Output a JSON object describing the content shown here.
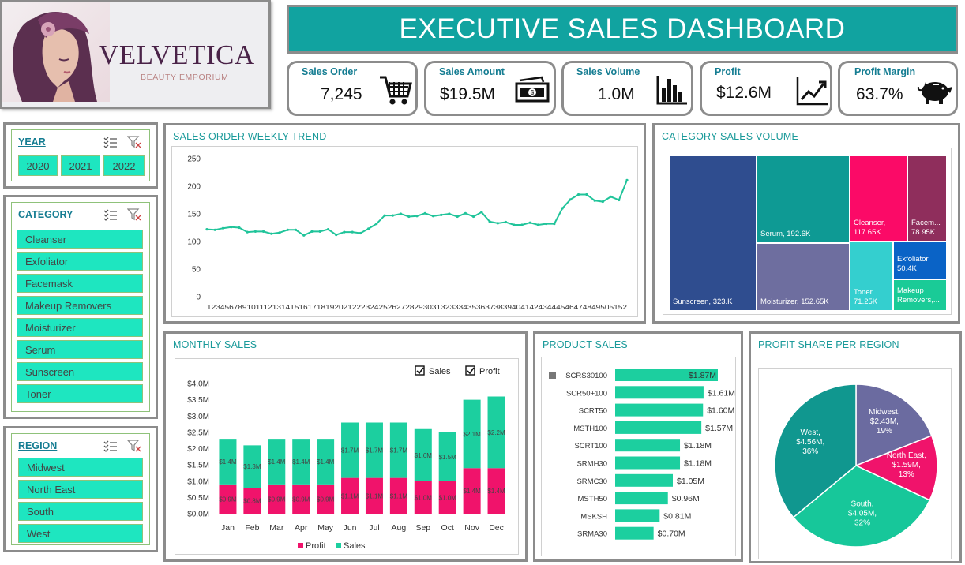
{
  "brand": {
    "name": "VELVETICA",
    "subtitle": "BEAUTY EMPORIUM"
  },
  "title": "EXECUTIVE SALES DASHBOARD",
  "kpis": [
    {
      "label": "Sales Order",
      "value": "7,245",
      "icon": "shopping-cart-icon"
    },
    {
      "label": "Sales Amount",
      "value": "$19.5M",
      "icon": "money-icon"
    },
    {
      "label": "Sales Volume",
      "value": "1.0M",
      "icon": "bar-chart-icon"
    },
    {
      "label": "Profit",
      "value": "$12.6M",
      "icon": "trend-up-icon"
    },
    {
      "label": "Profit Margin",
      "value": "63.7%",
      "icon": "piggy-bank-icon"
    }
  ],
  "slicers": {
    "year": {
      "title": "YEAR",
      "items": [
        "2020",
        "2021",
        "2022"
      ]
    },
    "category": {
      "title": "CATEGORY",
      "items": [
        "Cleanser",
        "Exfoliator",
        "Facemask",
        "Makeup Removers",
        "Moisturizer",
        "Serum",
        "Sunscreen",
        "Toner"
      ]
    },
    "region": {
      "title": "REGION",
      "items": [
        "Midwest",
        "North East",
        "South",
        "West"
      ]
    }
  },
  "colors": {
    "teal": "#11a3a0",
    "slicer_fill": "#1ee6c0",
    "sales": "#1ccf9f",
    "profit": "#f0136b",
    "line": "#20c49a"
  },
  "chart_data": [
    {
      "type": "line",
      "title": "SALES ORDER WEEKLY TREND",
      "x": [
        1,
        2,
        3,
        4,
        5,
        6,
        7,
        8,
        9,
        10,
        11,
        12,
        13,
        14,
        15,
        16,
        17,
        18,
        19,
        20,
        21,
        22,
        23,
        24,
        25,
        26,
        27,
        28,
        29,
        30,
        31,
        32,
        33,
        34,
        35,
        36,
        37,
        38,
        39,
        40,
        41,
        42,
        43,
        44,
        45,
        46,
        47,
        48,
        49,
        50,
        51,
        52
      ],
      "x_tick_labels": "12345678910111213141516171819202122232425262728293031323334353637383940414243444546474849505152",
      "values": [
        122,
        121,
        124,
        126,
        125,
        117,
        118,
        118,
        114,
        116,
        121,
        121,
        111,
        118,
        118,
        122,
        112,
        117,
        117,
        115,
        123,
        132,
        147,
        147,
        150,
        145,
        146,
        151,
        146,
        148,
        150,
        145,
        151,
        145,
        153,
        136,
        133,
        135,
        130,
        130,
        134,
        130,
        132,
        132,
        160,
        176,
        185,
        185,
        174,
        172,
        181,
        175,
        211
      ],
      "ylim": [
        0,
        250
      ],
      "yticks": [
        "0",
        "50",
        "100",
        "150",
        "200",
        "250"
      ],
      "grid": false
    },
    {
      "type": "treemap",
      "title": "CATEGORY SALES VOLUME",
      "items": [
        {
          "label": "Sunscreen, 323.K",
          "value": 323.0,
          "color": "#2f4d8f"
        },
        {
          "label": "Serum, 192.6K",
          "value": 192.6,
          "color": "#0e9a94"
        },
        {
          "label": "Moisturizer, 152.65K",
          "value": 152.65,
          "color": "#6e6e9f"
        },
        {
          "label": "Cleanser, 117.65K",
          "value": 117.65,
          "color": "#fb0a67"
        },
        {
          "label": "Facem...",
          "value_label": "78.95K",
          "value": 78.95,
          "color": "#8f2e5c"
        },
        {
          "label": "Toner, 71.25K",
          "value": 71.25,
          "color": "#34cfcf"
        },
        {
          "label": "Exfoliator, 50.4K",
          "value": 50.4,
          "color": "#0a63c6"
        },
        {
          "label": "Makeup Removers,...",
          "value": 48.0,
          "color": "#1acb97"
        }
      ]
    },
    {
      "type": "bar",
      "title": "MONTHLY SALES",
      "categories": [
        "Jan",
        "Feb",
        "Mar",
        "Apr",
        "May",
        "Jun",
        "Jul",
        "Aug",
        "Sep",
        "Oct",
        "Nov",
        "Dec"
      ],
      "series": [
        {
          "name": "Profit",
          "values": [
            0.9,
            0.8,
            0.9,
            0.9,
            0.9,
            1.1,
            1.1,
            1.1,
            1.0,
            1.0,
            1.4,
            1.4
          ],
          "labels": [
            "$0.9M",
            "$0.8M",
            "$0.9M",
            "$0.9M",
            "$0.9M",
            "$1.1M",
            "$1.1M",
            "$1.1M",
            "$1.0M",
            "$1.0M",
            "$1.4M",
            "$1.4M"
          ]
        },
        {
          "name": "Sales",
          "values": [
            1.4,
            1.3,
            1.4,
            1.4,
            1.4,
            1.7,
            1.7,
            1.7,
            1.6,
            1.5,
            2.1,
            2.2
          ],
          "labels": [
            "$1.4M",
            "$1.3M",
            "$1.4M",
            "$1.4M",
            "$1.4M",
            "$1.7M",
            "$1.7M",
            "$1.7M",
            "$1.6M",
            "$1.5M",
            "$2.1M",
            "$2.2M"
          ]
        }
      ],
      "stacked": true,
      "ylim": [
        0,
        4.0
      ],
      "yticks": [
        "$0.0M",
        "$0.5M",
        "$1.0M",
        "$1.5M",
        "$2.0M",
        "$2.5M",
        "$3.0M",
        "$3.5M",
        "$4.0M"
      ],
      "legend": [
        "Profit",
        "Sales"
      ],
      "checkboxes": [
        "Sales",
        "Profit"
      ]
    },
    {
      "type": "bar",
      "orientation": "horizontal",
      "title": "PRODUCT SALES",
      "categories": [
        "SCRS30100",
        "SCR50+100",
        "SCRT50",
        "MSTH100",
        "SCRT100",
        "SRMH30",
        "SRMC30",
        "MSTH50",
        "MSKSH",
        "SRMA30"
      ],
      "values": [
        1.87,
        1.61,
        1.6,
        1.57,
        1.18,
        1.18,
        1.05,
        0.96,
        0.81,
        0.7
      ],
      "labels": [
        "$1.87M",
        "$1.61M",
        "$1.60M",
        "$1.57M",
        "$1.18M",
        "$1.18M",
        "$1.05M",
        "$0.96M",
        "$0.81M",
        "$0.70M"
      ]
    },
    {
      "type": "pie",
      "title": "PROFIT SHARE PER REGION",
      "slices": [
        {
          "name": "Midwest",
          "value": 19,
          "label": [
            "Midwest,",
            "$2.43M,",
            "19%"
          ],
          "color": "#6b6ba0"
        },
        {
          "name": "North East",
          "value": 13,
          "label": [
            "North East,",
            "$1.59M,",
            "13%"
          ],
          "color": "#f0136b"
        },
        {
          "name": "South",
          "value": 32,
          "label": [
            "South,",
            "$4.05M,",
            "32%"
          ],
          "color": "#17c79a"
        },
        {
          "name": "West",
          "value": 36,
          "label": [
            "West,",
            "$4.56M,",
            "36%"
          ],
          "color": "#10978f"
        }
      ]
    }
  ]
}
